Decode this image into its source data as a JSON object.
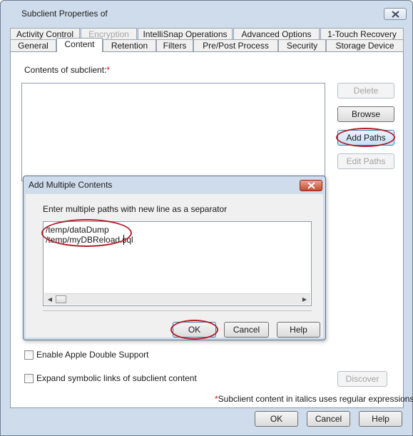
{
  "window": {
    "title": "Subclient Properties of"
  },
  "tabs_row_back": [
    "Activity Control",
    "Encryption",
    "IntelliSnap Operations",
    "Advanced Options",
    "1-Touch Recovery"
  ],
  "tabs_row_front": [
    "General",
    "Content",
    "Retention",
    "Filters",
    "Pre/Post Process",
    "Security",
    "Storage Device"
  ],
  "content": {
    "contents_label": "Contents of subclient:",
    "required_mark": "*",
    "side_buttons": {
      "delete": "Delete",
      "browse": "Browse",
      "add_paths": "Add Paths",
      "edit_paths": "Edit Paths"
    },
    "apple_double_label": "Enable Apple Double Support",
    "symbolic_links_label": "Expand symbolic links of subclient content",
    "discover_button": "Discover",
    "italic_note": "Subclient content in italics uses regular expressions"
  },
  "dialog": {
    "title": "Add Multiple Contents",
    "instruction": "Enter multiple paths with new line as a separator",
    "paths": [
      "/temp/dataDump",
      "/temp/myDBReload.sql"
    ],
    "ok": "OK",
    "cancel": "Cancel",
    "help": "Help"
  },
  "footer": {
    "ok": "OK",
    "cancel": "Cancel",
    "help": "Help"
  },
  "colors": {
    "window_frame": "#cfdceb",
    "highlight_ring": "#b3202a",
    "required": "#d21414",
    "dialog_close": "#c84a2e"
  },
  "icons": [
    "close-icon",
    "scroll-left-icon",
    "scroll-right-icon"
  ]
}
